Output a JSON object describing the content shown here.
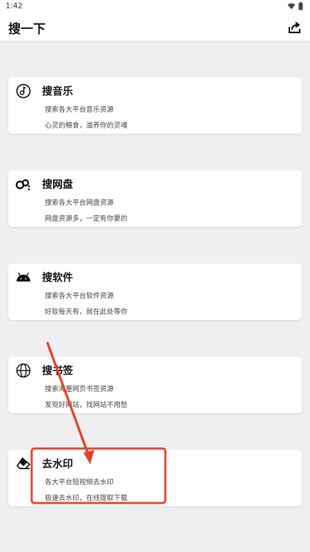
{
  "status_bar": {
    "time": "1:42",
    "wifi_icon": "wifi-icon",
    "battery_icon": "battery-icon"
  },
  "app_bar": {
    "title": "搜一下",
    "share_icon": "share-icon"
  },
  "cards": [
    {
      "icon": "music-note-icon",
      "title": "搜音乐",
      "line1": "搜索各大平台音乐资源",
      "line2": "心灵的粮食，滋养你的灵魂"
    },
    {
      "icon": "cloud-disk-icon",
      "title": "搜网盘",
      "line1": "搜索各大平台网盘资源",
      "line2": "网盘资源多，一定有你要的"
    },
    {
      "icon": "android-icon",
      "title": "搜软件",
      "line1": "搜索各大平台软件资源",
      "line2": "好软每天有，就在此处等你"
    },
    {
      "icon": "globe-icon",
      "title": "搜书签",
      "line1": "搜索海量网页书签资源",
      "line2": "发现好网站，找网站不用愁"
    },
    {
      "icon": "eraser-icon",
      "title": "去水印",
      "line1": "各大平台短视频去水印",
      "line2": "极速去水印，在线提取下载"
    }
  ],
  "annotation": {
    "color": "#e8412b"
  }
}
